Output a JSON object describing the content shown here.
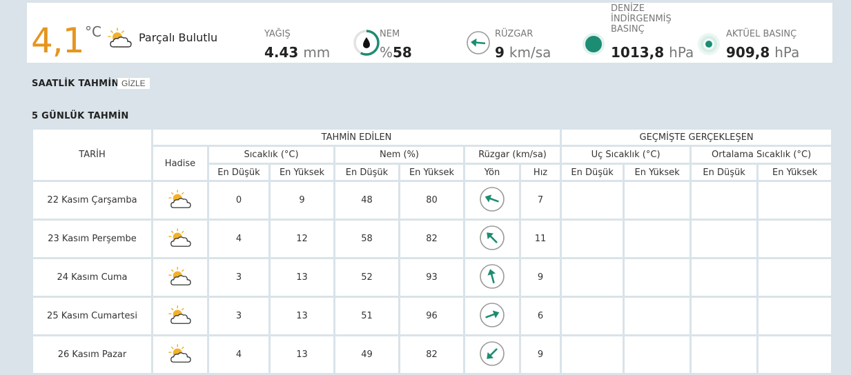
{
  "current": {
    "temperature": "4,1",
    "temp_unit": "°C",
    "icon": "partly-cloudy-icon",
    "condition": "Parçalı Bulutlu",
    "precip_label": "YAĞIŞ",
    "precip_value": "4.43",
    "precip_unit": "mm",
    "humidity_label": "NEM",
    "humidity_prefix": "%",
    "humidity_value": "58",
    "humidity_fraction": 0.58,
    "wind_label": "RÜZGAR",
    "wind_value": "9",
    "wind_unit": "km/sa",
    "sea_pressure_label": "DENİZE İNDİRGENMİŞ BASINÇ",
    "sea_pressure_label_lines": [
      "DENİZE",
      "İNDİRGENMİŞ",
      "BASINÇ"
    ],
    "sea_pressure_value": "1013,8",
    "sea_pressure_unit": "hPa",
    "actual_pressure_label": "AKTÜEL BASINÇ",
    "actual_pressure_value": "909,8",
    "actual_pressure_unit": "hPa"
  },
  "hourly": {
    "title": "SAATLİK TAHMİN",
    "toggle_label": "GİZLE"
  },
  "five_day": {
    "title": "5 GÜNLÜK TAHMİN",
    "headers": {
      "date": "TARİH",
      "forecast": "TAHMİN EDİLEN",
      "past": "GEÇMİŞTE GERÇEKLEŞEN",
      "event": "Hadise",
      "temperature": "Sıcaklık (°C)",
      "humidity": "Nem (%)",
      "wind": "Rüzgar (km/sa)",
      "extreme_temp": "Uç Sıcaklık (°C)",
      "avg_temp": "Ortalama Sıcaklık (°C)",
      "low": "En Düşük",
      "high": "En Yüksek",
      "direction": "Yön",
      "speed": "Hız"
    },
    "rows": [
      {
        "date": "22 Kasım Çarşamba",
        "icon": "partly-cloudy-icon",
        "t_low": "0",
        "t_high": "9",
        "h_low": "48",
        "h_high": "80",
        "wind_dir_deg": 110,
        "wind_speed": "7"
      },
      {
        "date": "23 Kasım Perşembe",
        "icon": "partly-cloudy-icon",
        "t_low": "4",
        "t_high": "12",
        "h_low": "58",
        "h_high": "82",
        "wind_dir_deg": 135,
        "wind_speed": "11"
      },
      {
        "date": "24 Kasım Cuma",
        "icon": "partly-cloudy-icon",
        "t_low": "3",
        "t_high": "13",
        "h_low": "52",
        "h_high": "93",
        "wind_dir_deg": 165,
        "wind_speed": "9"
      },
      {
        "date": "25 Kasım Cumartesi",
        "icon": "partly-cloudy-icon",
        "t_low": "3",
        "t_high": "13",
        "h_low": "51",
        "h_high": "96",
        "wind_dir_deg": 250,
        "wind_speed": "6"
      },
      {
        "date": "26 Kasım Pazar",
        "icon": "partly-cloudy-icon",
        "t_low": "4",
        "t_high": "13",
        "h_low": "49",
        "h_high": "82",
        "wind_dir_deg": 45,
        "wind_speed": "9"
      }
    ]
  },
  "colors": {
    "accent_orange": "#e5951f",
    "teal": "#1c8c72",
    "low_blue": "#1b6d8f",
    "high_red": "#b0243a",
    "humidity_low": "#cf8a14",
    "humidity_high": "#4e3f73"
  }
}
